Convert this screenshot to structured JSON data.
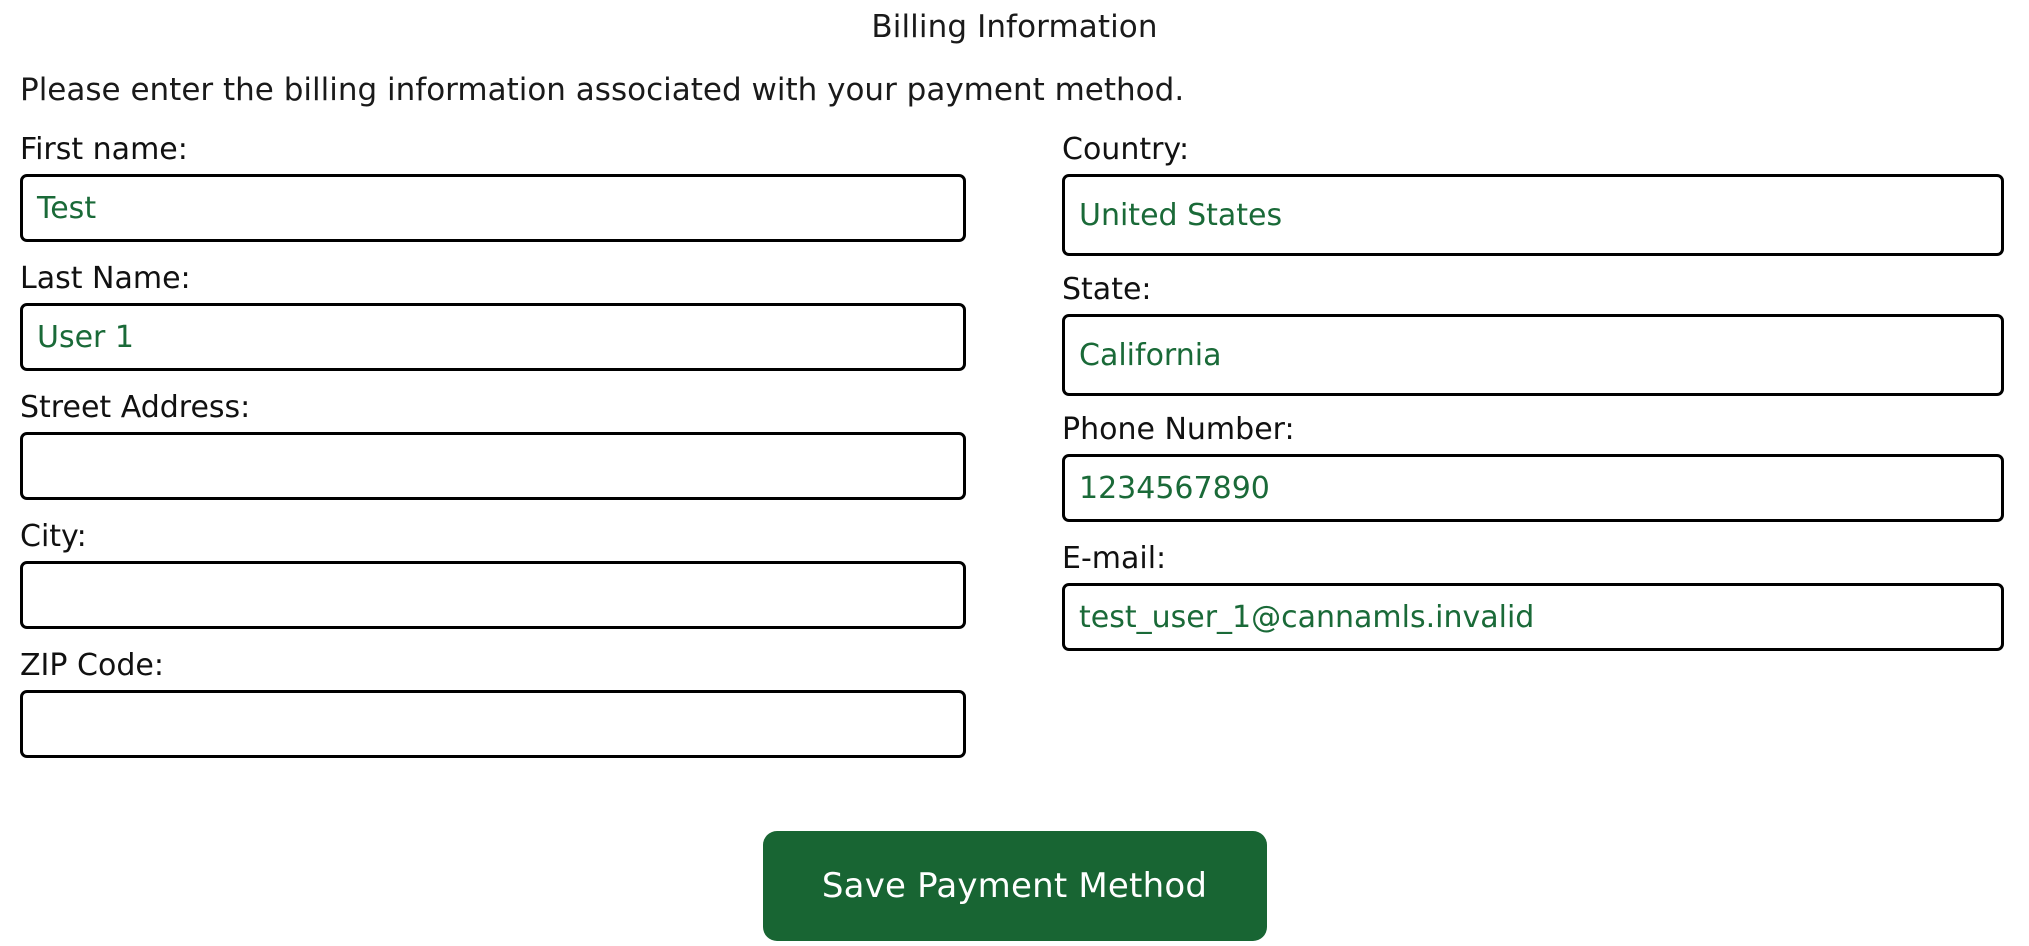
{
  "header": {
    "title": "Billing Information",
    "instructions": "Please enter the billing information associated with your payment method."
  },
  "colors": {
    "accent_green": "#186533",
    "input_text_green": "#1a6a38",
    "border_black": "#000000",
    "background": "#ffffff"
  },
  "form": {
    "left_column": [
      {
        "label": "First name:",
        "value": "Test",
        "placeholder": "",
        "control": "text"
      },
      {
        "label": "Last Name:",
        "value": "User 1",
        "placeholder": "",
        "control": "text"
      },
      {
        "label": "Street Address:",
        "value": "",
        "placeholder": "",
        "control": "text"
      },
      {
        "label": "City:",
        "value": "",
        "placeholder": "",
        "control": "text"
      },
      {
        "label": "ZIP Code:",
        "value": "",
        "placeholder": "",
        "control": "text"
      }
    ],
    "right_column": [
      {
        "label": "Country:",
        "value": "United States",
        "placeholder": "",
        "control": "select"
      },
      {
        "label": "State:",
        "value": "California",
        "placeholder": "",
        "control": "select"
      },
      {
        "label": "Phone Number:",
        "value": "1234567890",
        "placeholder": "",
        "control": "text"
      },
      {
        "label": "E-mail:",
        "value": "test_user_1@cannamls.invalid",
        "placeholder": "",
        "control": "text"
      }
    ]
  },
  "actions": {
    "save_label": "Save Payment Method"
  }
}
